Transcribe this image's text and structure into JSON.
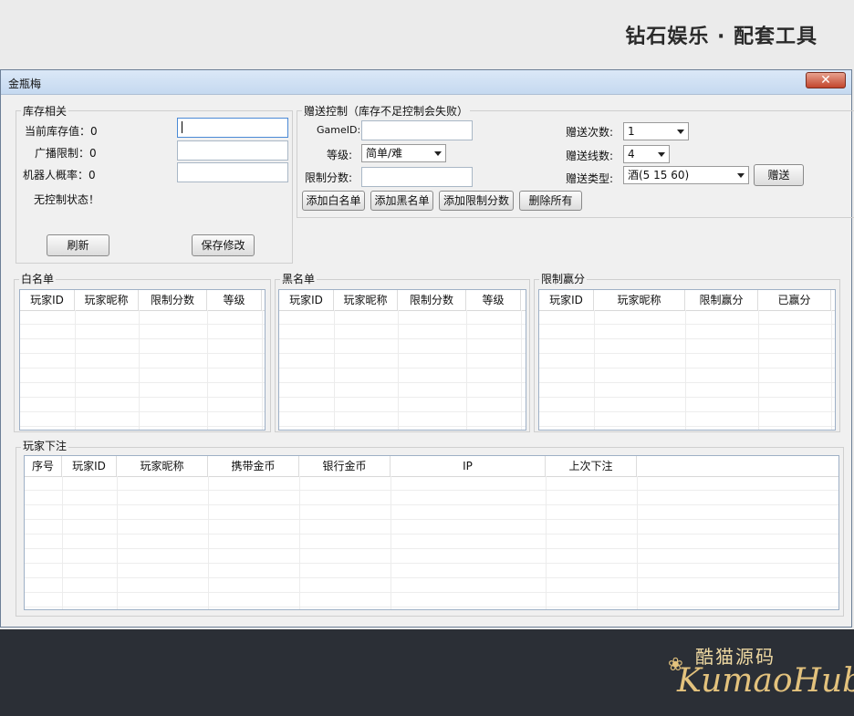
{
  "banner": {
    "title": "钻石娱乐 · 配套工具"
  },
  "watermark": {
    "cn": "酷猫源码",
    "en": "KumaoHub"
  },
  "window": {
    "title": "金瓶梅",
    "close": "✕"
  },
  "inventory": {
    "title": "库存相关",
    "current_label": "当前库存值：0",
    "broadcast_label": "广播限制：0",
    "robot_label": "机器人概率：0",
    "status": "无控制状态！",
    "refresh": "刷新",
    "save": "保存修改"
  },
  "gift": {
    "title": "赠送控制（库存不足控制会失败）",
    "gameid_label": "GameID:",
    "level_label": "等级:",
    "level_value": "简单/难",
    "limit_label": "限制分数:",
    "times_label": "赠送次数:",
    "times_value": "1",
    "lines_label": "赠送线数:",
    "lines_value": "4",
    "type_label": "赠送类型:",
    "type_value": "酒(5 15 60)",
    "send_button": "赠送",
    "add_white": "添加白名单",
    "add_black": "添加黑名单",
    "add_limit": "添加限制分数",
    "delete_all": "删除所有"
  },
  "whitelist": {
    "title": "白名单",
    "columns": [
      "玩家ID",
      "玩家昵称",
      "限制分数",
      "等级"
    ]
  },
  "blacklist": {
    "title": "黑名单",
    "columns": [
      "玩家ID",
      "玩家昵称",
      "限制分数",
      "等级"
    ]
  },
  "limitwin": {
    "title": "限制赢分",
    "columns": [
      "玩家ID",
      "玩家昵称",
      "限制赢分",
      "已赢分"
    ]
  },
  "bets": {
    "title": "玩家下注",
    "columns": [
      "序号",
      "玩家ID",
      "玩家昵称",
      "携带金币",
      "银行金币",
      "IP",
      "上次下注"
    ]
  }
}
